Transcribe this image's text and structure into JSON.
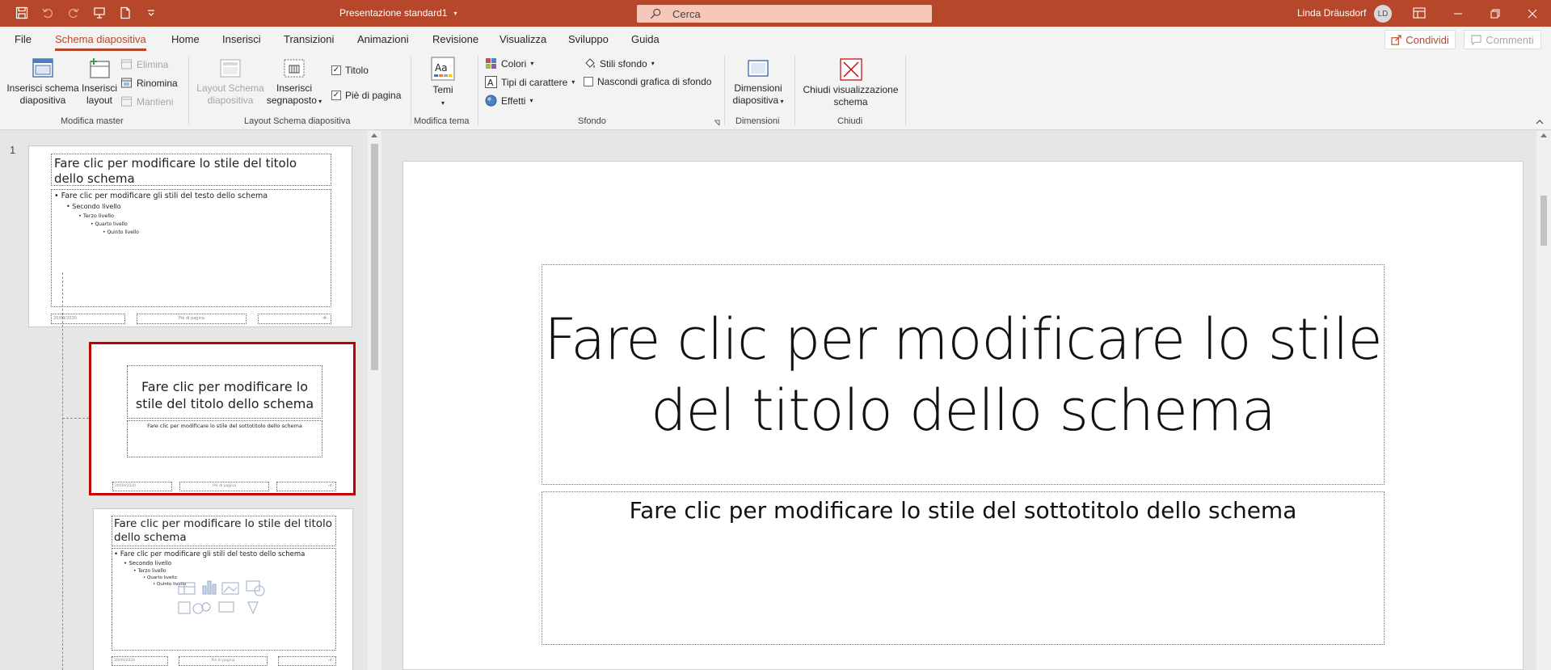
{
  "titlebar": {
    "doc_title": "Presentazione standard1",
    "search_placeholder": "Cerca",
    "user_name": "Linda Dräusdorf",
    "user_initials": "LD"
  },
  "tabs": [
    {
      "label": "File"
    },
    {
      "label": "Schema diapositiva"
    },
    {
      "label": "Home"
    },
    {
      "label": "Inserisci"
    },
    {
      "label": "Transizioni"
    },
    {
      "label": "Animazioni"
    },
    {
      "label": "Revisione"
    },
    {
      "label": "Visualizza"
    },
    {
      "label": "Sviluppo"
    },
    {
      "label": "Guida"
    }
  ],
  "share": {
    "share_label": "Condividi",
    "comments_label": "Commenti"
  },
  "ribbon": {
    "modifica_master": {
      "label": "Modifica master",
      "insert_master": "Inserisci schema diapositiva",
      "insert_layout": "Inserisci layout",
      "delete": "Elimina",
      "rename": "Rinomina",
      "preserve": "Mantieni"
    },
    "layout_schema": {
      "label": "Layout Schema diapositiva",
      "layout_master": "Layout Schema diapositiva",
      "insert_placeholder": "Inserisci segnaposto",
      "title_check": "Titolo",
      "footer_check": "Piè di pagina"
    },
    "modifica_tema": {
      "label": "Modifica tema",
      "themes": "Temi"
    },
    "sfondo": {
      "label": "Sfondo",
      "colors": "Colori",
      "fonts": "Tipi di carattere",
      "effects": "Effetti",
      "bg_styles": "Stili sfondo",
      "hide_bg": "Nascondi grafica di sfondo"
    },
    "dimensioni": {
      "label": "Dimensioni",
      "slide_size": "Dimensioni diapositiva"
    },
    "chiudi": {
      "label": "Chiudi",
      "close_master": "Chiudi visualizzazione schema"
    }
  },
  "thumbnails": {
    "slide_number": "1",
    "master": {
      "title": "Fare clic per modificare lo stile del titolo dello schema",
      "bullets": [
        "Fare clic per modificare gli stili del testo dello schema",
        "Secondo livello",
        "Terzo livello",
        "Quarto livello",
        "Quinto livello"
      ],
      "footer_date": "20/09/2020",
      "footer_center": "Piè di pagina",
      "footer_num": "‹#›"
    },
    "layout1": {
      "title": "Fare clic per modificare lo stile del titolo dello schema",
      "subtitle": "Fare clic per modificare lo stile del sottotitolo dello schema",
      "footer_date": "20/09/2020",
      "footer_center": "Piè di pagina",
      "footer_num": "‹#›"
    },
    "layout2": {
      "title": "Fare clic per modificare lo stile del titolo dello schema",
      "bullets": [
        "Fare clic per modificare gli stili del testo dello schema",
        "Secondo livello",
        "Terzo livello",
        "Quarto livello",
        "Quinto livello"
      ],
      "footer_date": "20/09/2020",
      "footer_center": "Piè di pagina",
      "footer_num": "‹#›"
    }
  },
  "slide": {
    "title": "Fare clic per modificare lo stile del titolo dello schema",
    "subtitle": "Fare clic per modificare lo stile del sottotitolo dello schema"
  },
  "colors": {
    "accent": "#b7472a",
    "selected_border": "#c00000"
  }
}
